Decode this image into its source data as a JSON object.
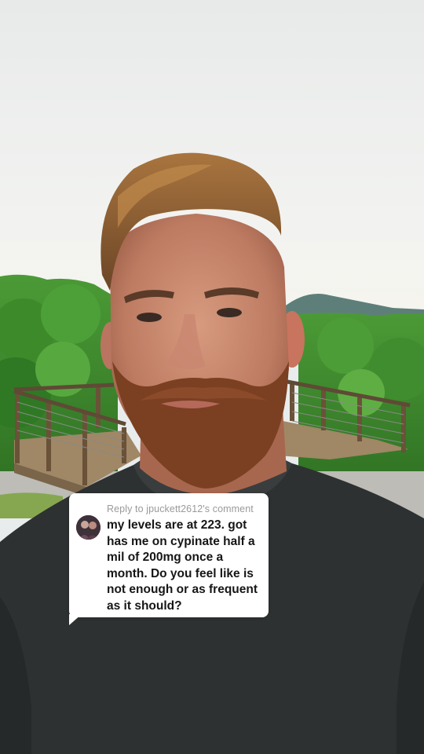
{
  "reply": {
    "header": "Reply to jpuckett2612's comment",
    "text": "my levels are at 223. got has me on cypinate half a mil of 200mg once a month. Do you feel like is not enough or as frequent as it should?",
    "avatar_icon": "user-avatar-icon"
  },
  "colors": {
    "sky": "#eef0ef",
    "foliage": "#3f8b2d",
    "shirt": "#2f3233",
    "card": "#ffffff",
    "card_text": "#161616",
    "card_subtext": "#9a9a9a"
  }
}
